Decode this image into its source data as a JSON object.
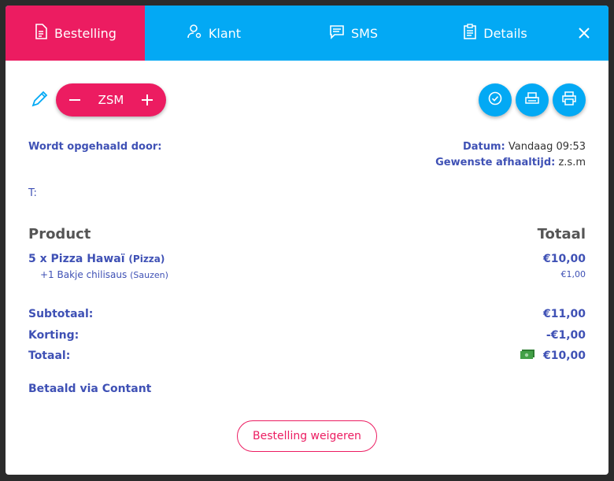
{
  "tabs": [
    {
      "label": "Bestelling",
      "icon": "document-icon",
      "active": true
    },
    {
      "label": "Klant",
      "icon": "user-icon"
    },
    {
      "label": "SMS",
      "icon": "message-icon"
    },
    {
      "label": "Details",
      "icon": "clipboard-icon"
    }
  ],
  "stepper": {
    "value": "ZSM"
  },
  "pickup": {
    "label": "Wordt opgehaald door:",
    "phone_label": "T:"
  },
  "meta": {
    "date_label": "Datum:",
    "date_value": "Vandaag 09:53",
    "time_label": "Gewenste afhaaltijd:",
    "time_value": "z.s.m"
  },
  "table": {
    "col_product": "Product",
    "col_total": "Totaal",
    "items": [
      {
        "name": "5 x Pizza Hawaï",
        "category": "(Pizza)",
        "price": "€10,00",
        "extra": "+1 Bakje chilisaus",
        "extra_category": "(Sauzen)",
        "extra_price": "€1,00"
      }
    ]
  },
  "totals": {
    "subtotal_label": "Subtotaal:",
    "subtotal_value": "€11,00",
    "discount_label": "Korting:",
    "discount_value": "-€1,00",
    "total_label": "Totaal:",
    "total_value": "€10,00"
  },
  "payment": {
    "label": "Betaald via Contant"
  },
  "actions": {
    "refuse_label": "Bestelling weigeren"
  },
  "colors": {
    "primary_blue": "#03a9f4",
    "accent_pink": "#ec1c61",
    "text_blue": "#3f51b5"
  }
}
